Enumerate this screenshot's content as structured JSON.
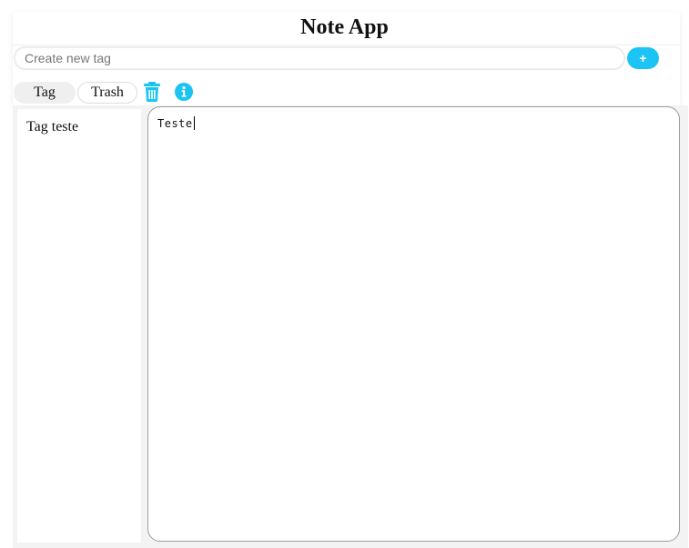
{
  "app": {
    "title": "Note App"
  },
  "tag_creator": {
    "placeholder": "Create new tag",
    "value": "",
    "add_label": "+"
  },
  "tabs": [
    {
      "label": "Tag",
      "active": true
    },
    {
      "label": "Trash",
      "active": false
    }
  ],
  "icons": {
    "delete": "trash-icon",
    "info": "info-icon",
    "accent_color": "#1cc4f4"
  },
  "sidebar": {
    "items": [
      {
        "label": "Tag teste"
      }
    ]
  },
  "editor": {
    "content": "Teste"
  }
}
